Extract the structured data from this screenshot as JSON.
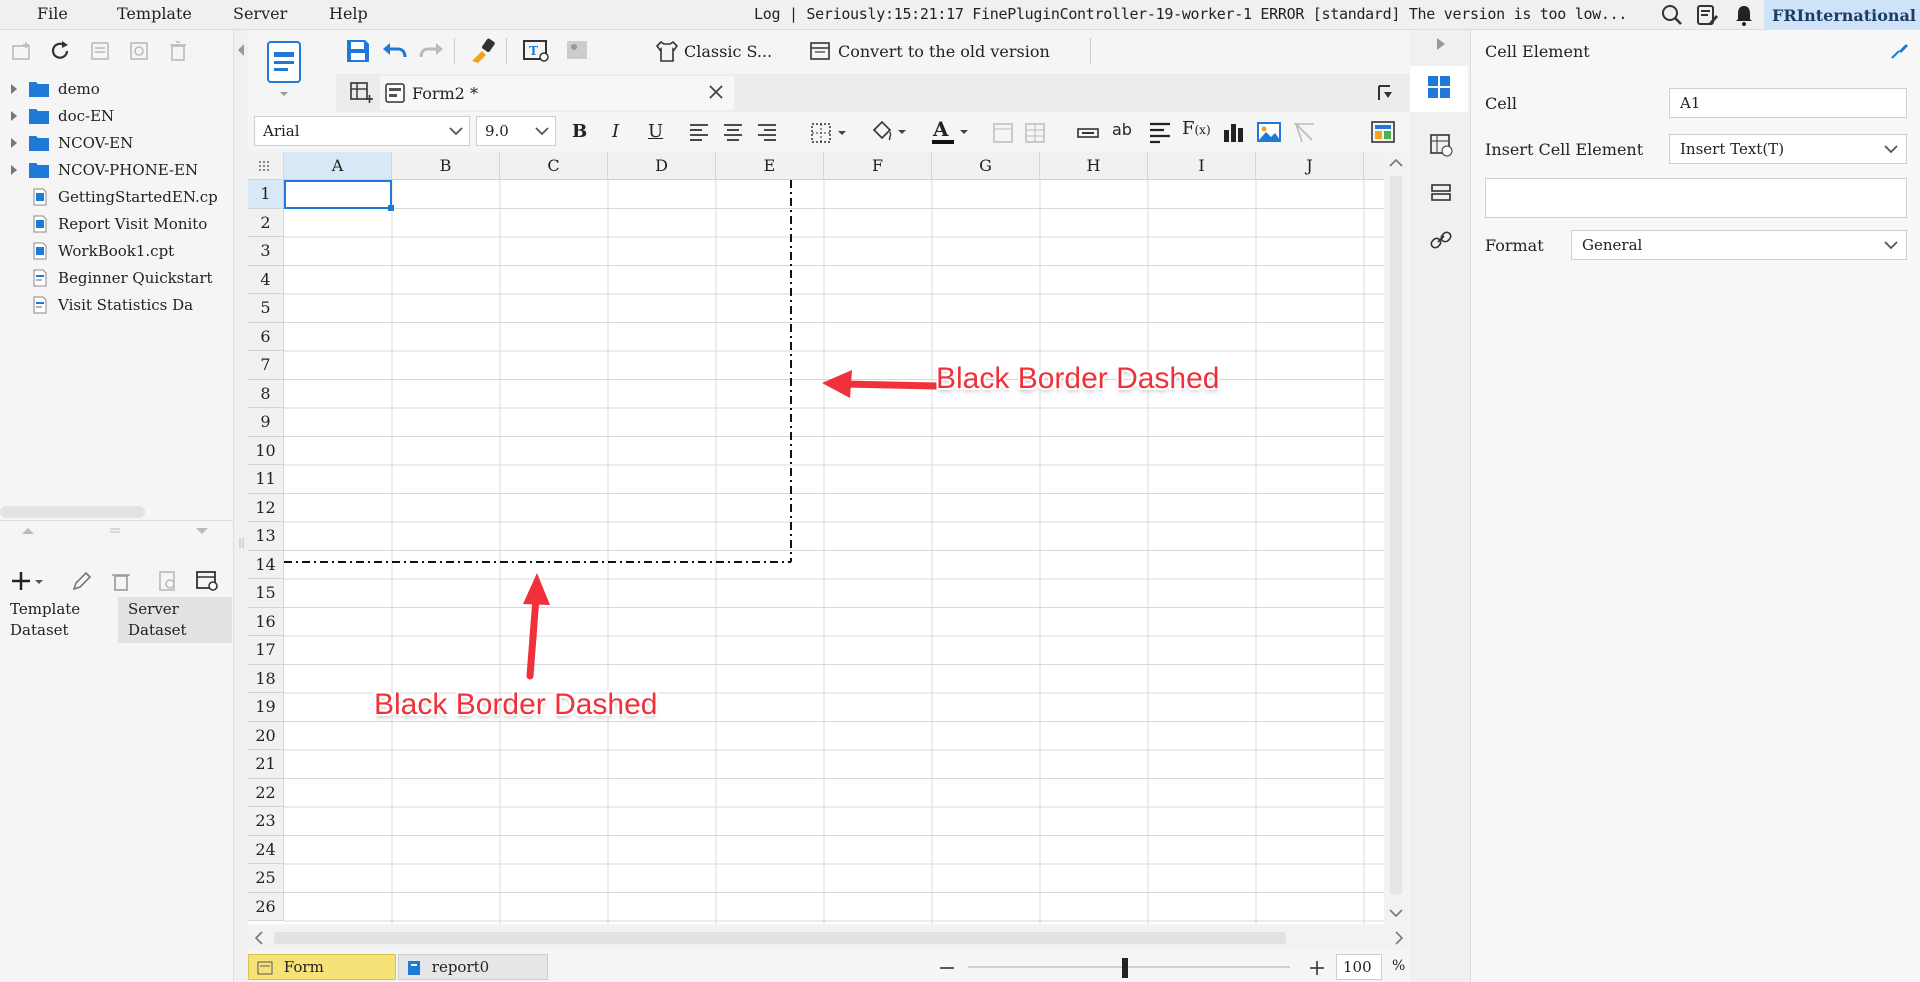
{
  "menu": {
    "items": [
      "File",
      "Template",
      "Server",
      "Help"
    ]
  },
  "log": {
    "label": "Log",
    "separator": "|",
    "message": "Seriously:15:21:17 FinePluginController-19-worker-1 ERROR [standard] The version is too low..."
  },
  "brand": "FRInternational",
  "tree": {
    "folders": [
      "demo",
      "doc-EN",
      "NCOV-EN",
      "NCOV-PHONE-EN"
    ],
    "files": [
      "GettingStartedEN.cp",
      "Report Visit Monito",
      "WorkBook1.cpt",
      "Beginner Quickstart",
      "Visit Statistics Da"
    ]
  },
  "dataset_tabs": {
    "template": "Template\nDataset",
    "server": "Server\nDataset"
  },
  "toolbar": {
    "classic_label": "Classic S...",
    "convert_label": "Convert to the old version"
  },
  "file_tab": {
    "name": "Form2 *"
  },
  "format": {
    "font": "Arial",
    "size": "9.0"
  },
  "grid": {
    "columns": [
      "A",
      "B",
      "C",
      "D",
      "E",
      "F",
      "G",
      "H",
      "I",
      "J"
    ],
    "rows": [
      "1",
      "2",
      "3",
      "4",
      "5",
      "6",
      "7",
      "8",
      "9",
      "10",
      "11",
      "12",
      "13",
      "14",
      "15",
      "16",
      "17",
      "18",
      "19",
      "20",
      "21",
      "22",
      "23",
      "24",
      "25",
      "26"
    ],
    "selected_cell": "A1"
  },
  "annotations": {
    "right": "Black Border Dashed",
    "bottom": "Black Border Dashed"
  },
  "sheets": {
    "form": "Form",
    "report": "report0"
  },
  "zoom": {
    "value": "100",
    "unit": "%"
  },
  "right_panel": {
    "title": "Cell Element",
    "cell_label": "Cell",
    "cell_value": "A1",
    "insert_label": "Insert Cell Element",
    "insert_value": "Insert Text(T)",
    "format_label": "Format",
    "format_value": "General"
  },
  "colors": {
    "accent": "#1e7ad6",
    "annotation": "#f0303a",
    "selection": "#d8e8f7"
  }
}
